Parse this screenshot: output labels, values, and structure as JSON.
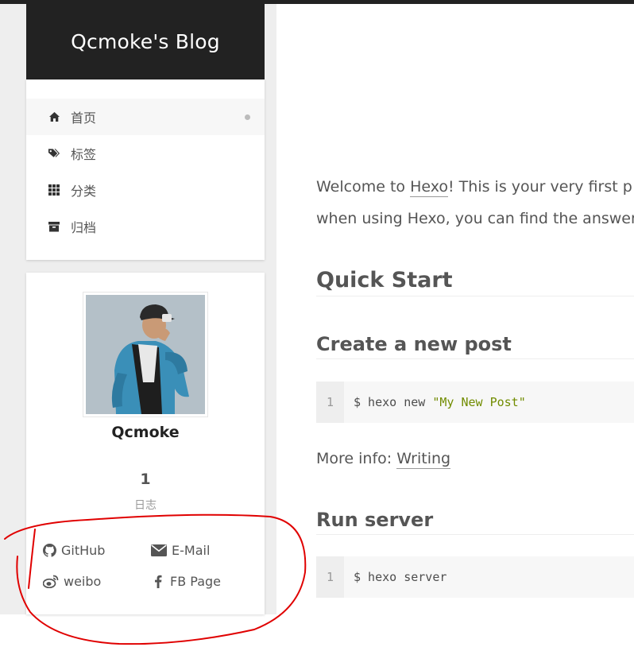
{
  "site": {
    "title": "Qcmoke's Blog"
  },
  "menu": {
    "items": [
      {
        "label": "首页",
        "icon": "home-icon",
        "active": true
      },
      {
        "label": "标签",
        "icon": "tags-icon",
        "active": false
      },
      {
        "label": "分类",
        "icon": "th-icon",
        "active": false
      },
      {
        "label": "归档",
        "icon": "archive-icon",
        "active": false
      }
    ]
  },
  "sidebar": {
    "author": "Qcmoke",
    "posts": {
      "count": "1",
      "label": "日志"
    },
    "links": [
      {
        "label": "GitHub",
        "icon": "github-icon"
      },
      {
        "label": "E-Mail",
        "icon": "envelope-icon"
      },
      {
        "label": "weibo",
        "icon": "weibo-icon"
      },
      {
        "label": "FB Page",
        "icon": "facebook-icon"
      }
    ]
  },
  "post": {
    "intro": {
      "line1_before": "Welcome to ",
      "line1_link": "Hexo",
      "line1_after": "! This is your very first p",
      "line2": "when using Hexo, you can find the answer"
    },
    "h_quick_start": "Quick Start",
    "h_create_post": "Create a new post",
    "code1": {
      "line_no": "1",
      "cmd": "$ hexo new ",
      "arg": "\"My New Post\""
    },
    "more_info": {
      "before": "More info: ",
      "link": "Writing"
    },
    "h_run_server": "Run server",
    "code2": {
      "line_no": "1",
      "cmd": "$ hexo server"
    }
  },
  "colors": {
    "header_bg": "#222222",
    "page_bg": "#eeeeee",
    "code_string": "#718c00",
    "annotation": "#e00000"
  }
}
